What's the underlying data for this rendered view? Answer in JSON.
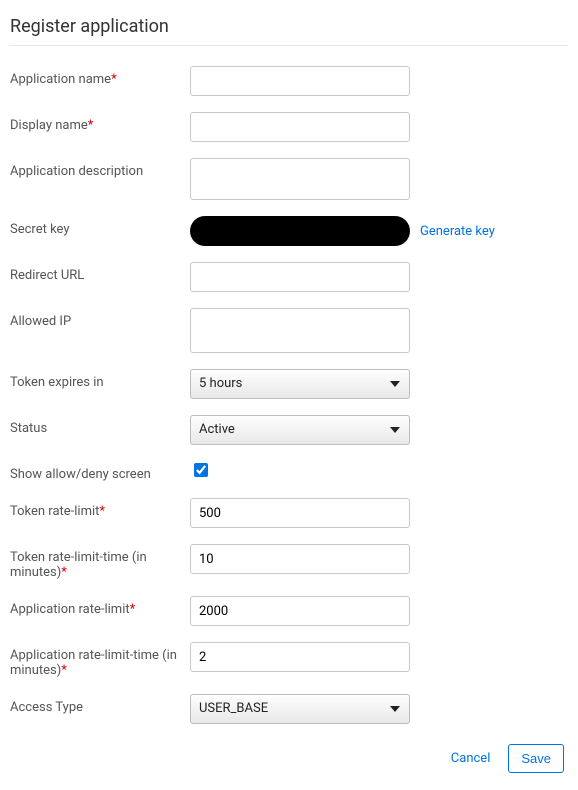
{
  "page": {
    "title": "Register application"
  },
  "fields": {
    "app_name": {
      "label": "Application name",
      "required": true,
      "value": ""
    },
    "display_name": {
      "label": "Display name",
      "required": true,
      "value": ""
    },
    "app_description": {
      "label": "Application description",
      "required": false,
      "value": ""
    },
    "secret_key": {
      "label": "Secret key",
      "required": false,
      "generate_label": "Generate key"
    },
    "redirect_url": {
      "label": "Redirect URL",
      "required": false,
      "value": ""
    },
    "allowed_ip": {
      "label": "Allowed IP",
      "required": false,
      "value": ""
    },
    "token_expires": {
      "label": "Token expires in",
      "selected": "5 hours"
    },
    "status": {
      "label": "Status",
      "selected": "Active"
    },
    "show_allow_deny": {
      "label": "Show allow/deny screen",
      "checked": true
    },
    "token_rate_limit": {
      "label": "Token rate-limit",
      "required": true,
      "value": "500"
    },
    "token_rate_limit_time": {
      "label": "Token rate-limit-time (in minutes)",
      "required": true,
      "value": "10"
    },
    "app_rate_limit": {
      "label": "Application rate-limit",
      "required": true,
      "value": "2000"
    },
    "app_rate_limit_time": {
      "label": "Application rate-limit-time (in minutes)",
      "required": true,
      "value": "2"
    },
    "access_type": {
      "label": "Access Type",
      "selected": "USER_BASE"
    }
  },
  "actions": {
    "cancel": "Cancel",
    "save": "Save"
  }
}
